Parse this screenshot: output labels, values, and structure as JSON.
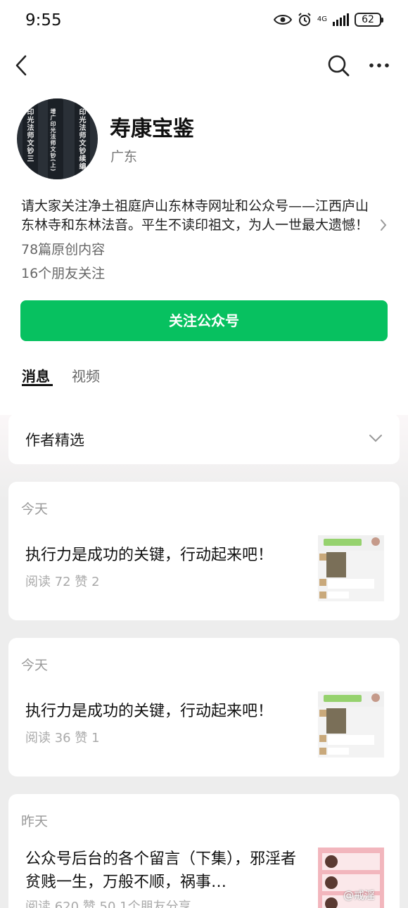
{
  "status_bar": {
    "time": "9:55",
    "network": "4G",
    "battery": "62"
  },
  "profile": {
    "name": "寿康宝鉴",
    "location": "广东",
    "description": "请大家关注净土祖庭庐山东林寺网址和公众号——江西庐山东林寺和东林法音。平生不读印祖文，为人一世最大遗憾！",
    "articles_count": "78篇原创内容",
    "friends_following": "16个朋友关注",
    "avatar_texts": [
      "印光法师文钞三",
      "增广印光法师文钞(上)",
      "印光法师文钞续编"
    ]
  },
  "follow_button": "关注公众号",
  "tabs": [
    {
      "label": "消息"
    },
    {
      "label": "视频"
    }
  ],
  "author_selection": {
    "label": "作者精选"
  },
  "posts": [
    {
      "day": "今天",
      "title": "执行力是成功的关键，行动起来吧！",
      "meta": "阅读 72  赞 2"
    },
    {
      "day": "今天",
      "title": "执行力是成功的关键，行动起来吧！",
      "meta": "阅读 36  赞 1"
    },
    {
      "day": "昨天",
      "title": "公众号后台的各个留言（下集），邪淫者贫贱一生，万般不顺，祸事…",
      "meta": "阅读 620  赞 50  1个朋友分享"
    }
  ],
  "watermark": "@戒淫",
  "colors": {
    "accent": "#07c160",
    "background": "#ededed"
  }
}
